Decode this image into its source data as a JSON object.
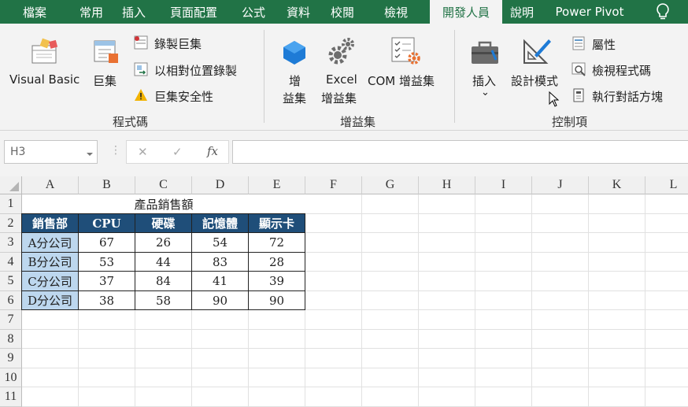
{
  "menu": {
    "tabs": [
      "檔案",
      "常用",
      "插入",
      "頁面配置",
      "公式",
      "資料",
      "校閱",
      "檢視",
      "開發人員",
      "說明",
      "Power Pivot"
    ],
    "active": "開發人員"
  },
  "ribbon": {
    "code": {
      "visual_basic": "Visual Basic",
      "macros": "巨集",
      "record_macro": "錄製巨集",
      "relative_refs": "以相對位置錄製",
      "macro_security": "巨集安全性",
      "group_label": "程式碼"
    },
    "addins": {
      "addins_line1": "增",
      "addins_line2": "益集",
      "excel_line1": "Excel",
      "excel_line2": "增益集",
      "com": "COM 增益集",
      "group_label": "增益集"
    },
    "controls": {
      "insert": "插入",
      "insert_arrow": "⌄",
      "design_mode": "設計模式",
      "properties": "屬性",
      "view_code": "檢視程式碼",
      "run_dialog": "執行對話方塊",
      "group_label": "控制項"
    }
  },
  "formula_bar": {
    "name_box": "H3",
    "cancel": "✕",
    "enter": "✓",
    "fx": "fx",
    "formula": ""
  },
  "sheet": {
    "columns": [
      "A",
      "B",
      "C",
      "D",
      "E",
      "F",
      "G",
      "H",
      "I",
      "J",
      "K",
      "L"
    ],
    "rows": [
      "1",
      "2",
      "3",
      "4",
      "5",
      "6",
      "7",
      "8",
      "9",
      "10",
      "11"
    ],
    "title": "產品銷售額",
    "headers": [
      "銷售部",
      "CPU",
      "硬碟",
      "記憶體",
      "顯示卡"
    ],
    "data": [
      [
        "A分公司",
        "67",
        "26",
        "54",
        "72"
      ],
      [
        "B分公司",
        "53",
        "44",
        "83",
        "28"
      ],
      [
        "C分公司",
        "37",
        "84",
        "41",
        "39"
      ],
      [
        "D分公司",
        "38",
        "58",
        "90",
        "90"
      ]
    ]
  },
  "colors": {
    "excel_green": "#217346",
    "header_fill": "#1f4e79",
    "branch_fill": "#bdd7ee"
  }
}
